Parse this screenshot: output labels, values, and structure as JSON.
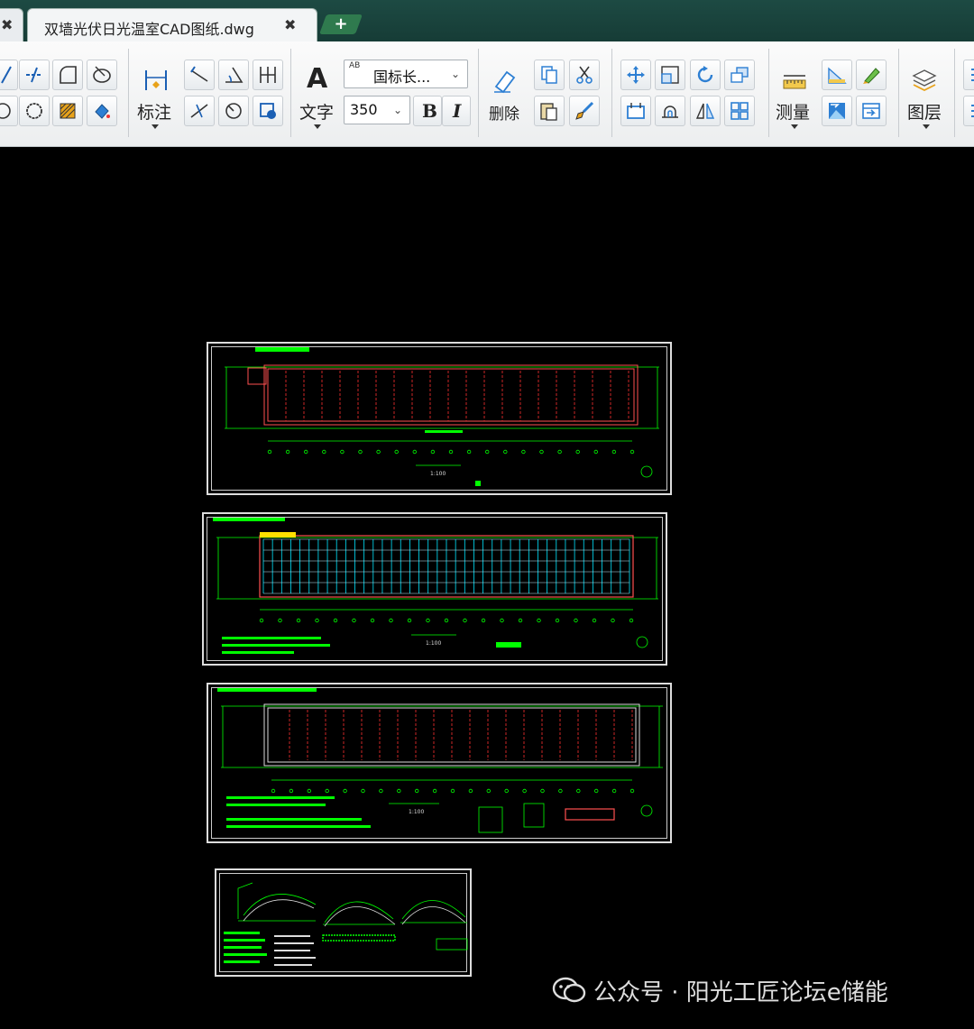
{
  "tabs": {
    "prev_close": "✖",
    "active_title": "双墙光伏日光温室CAD图纸.dwg",
    "active_close": "✖",
    "new_tab": "+"
  },
  "ribbon": {
    "dimension_label": "标注",
    "text_label": "文字",
    "text_icon": "A",
    "text_style_value": "国标长...",
    "text_style_prefix": "AB",
    "text_height_value": "350",
    "bold_label": "B",
    "italic_label": "I",
    "delete_label": "删除",
    "measure_label": "测量",
    "layer_label": "图层"
  },
  "drawings": {
    "scale_label_1": "1:100",
    "scale_label_2": "1:100",
    "scale_label_3": "1:100"
  },
  "watermark": {
    "text": "公众号 · 阳光工匠论坛e储能"
  },
  "colors": {
    "tabbar": "#1d4a43",
    "canvas": "#000000",
    "cad_green": "#00ff00",
    "cad_red": "#ff3030",
    "cad_cyan": "#00e5ff"
  }
}
